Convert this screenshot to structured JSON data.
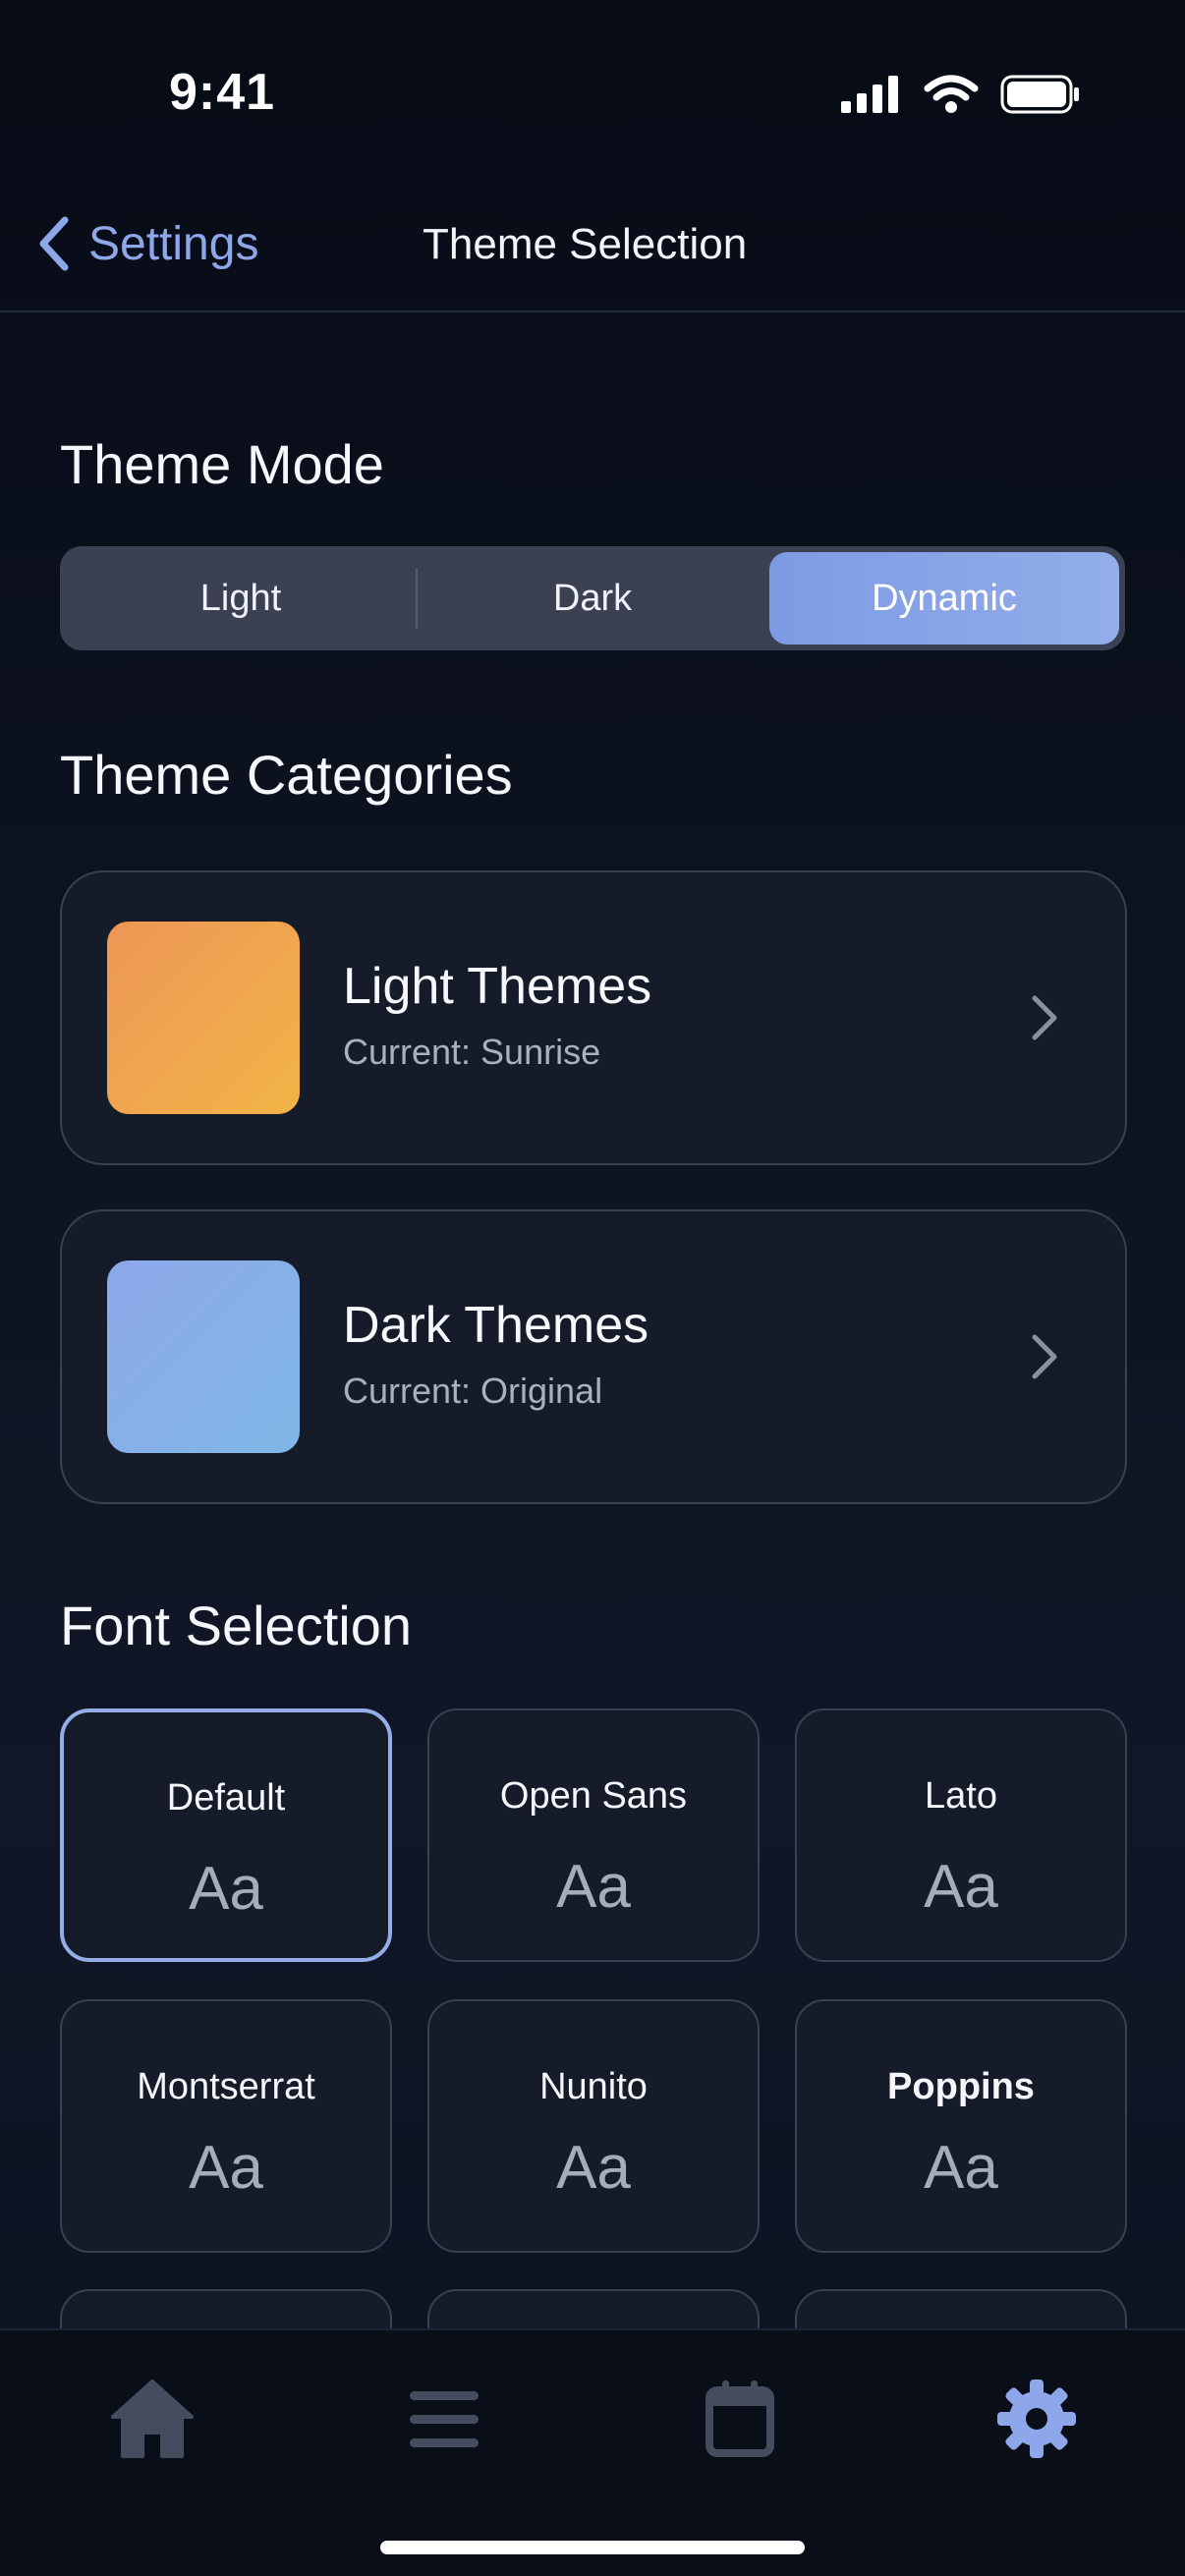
{
  "status": {
    "time": "9:41"
  },
  "nav": {
    "back_label": "Settings",
    "title": "Theme Selection"
  },
  "theme_mode": {
    "title": "Theme Mode",
    "options": [
      "Light",
      "Dark",
      "Dynamic"
    ],
    "selected": "Dynamic"
  },
  "theme_categories": {
    "title": "Theme Categories",
    "items": [
      {
        "label": "Light Themes",
        "current": "Current: Sunrise"
      },
      {
        "label": "Dark Themes",
        "current": "Current: Original"
      }
    ]
  },
  "font_selection": {
    "title": "Font Selection",
    "sample": "Aa",
    "fonts": [
      "Default",
      "Open Sans",
      "Lato",
      "Montserrat",
      "Nunito",
      "Poppins"
    ],
    "selected": "Default"
  },
  "tab_bar": {
    "tabs": [
      {
        "icon": "home-icon",
        "active": false
      },
      {
        "icon": "menu-icon",
        "active": false
      },
      {
        "icon": "calendar-icon",
        "active": false
      },
      {
        "icon": "gear-icon",
        "active": true
      }
    ]
  },
  "colors": {
    "accent": "#8ea6ea",
    "light_swatch": "#ef9f4f",
    "dark_swatch": "#88aee8",
    "inactive_tab": "#444b5d"
  }
}
